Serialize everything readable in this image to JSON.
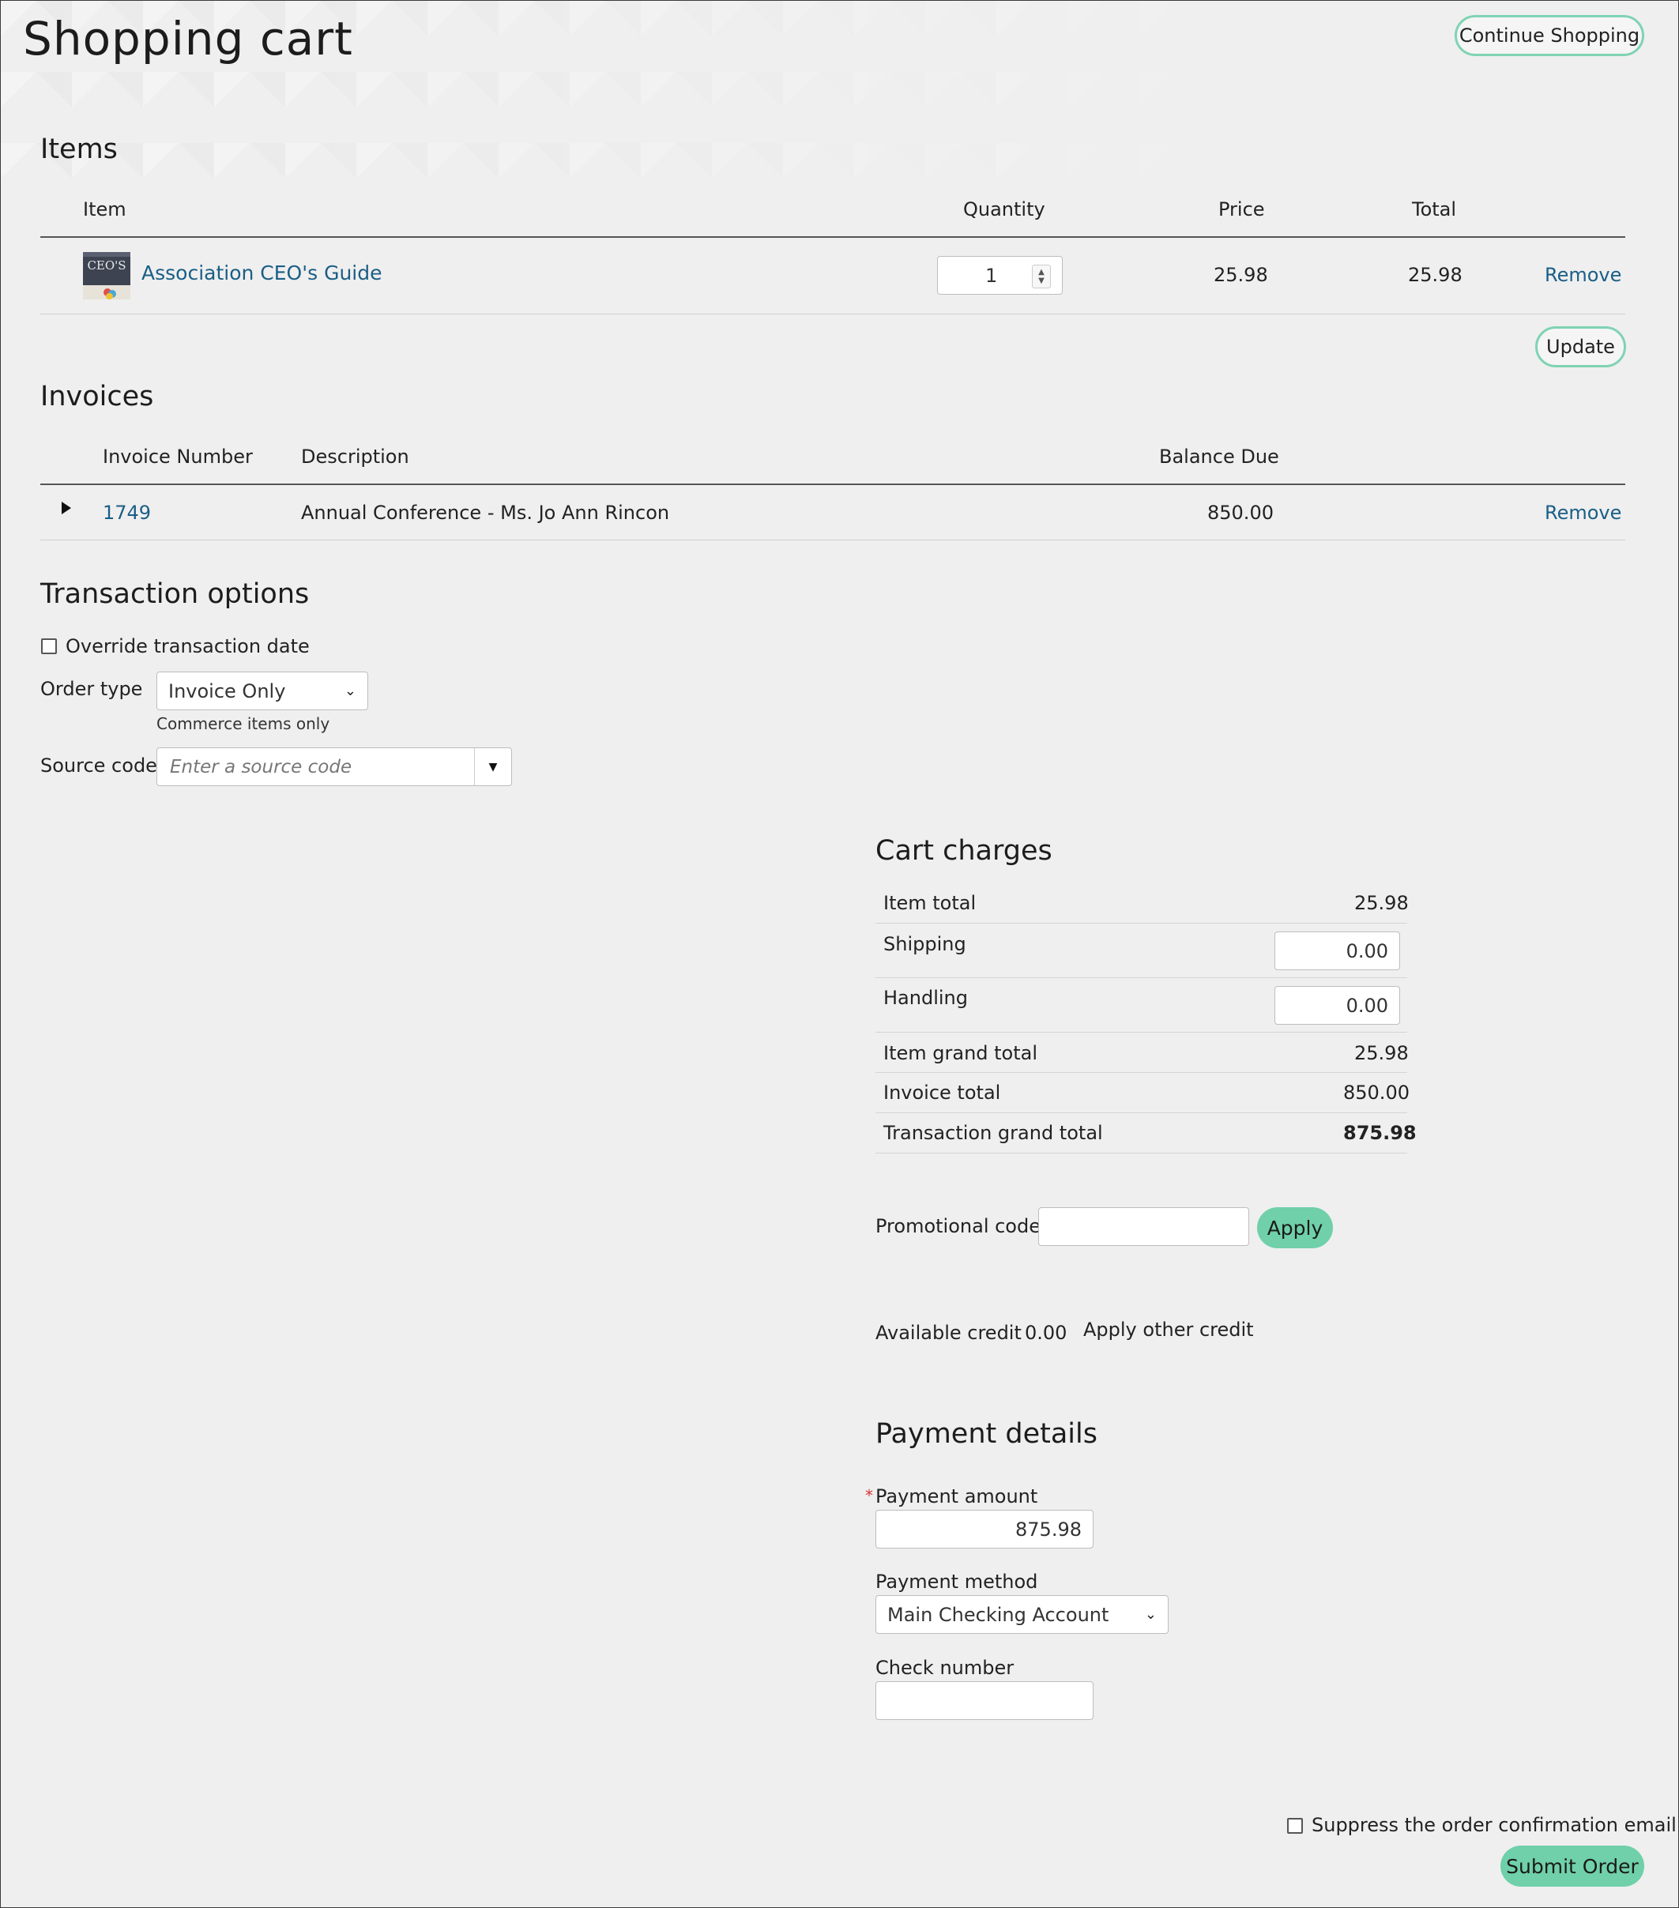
{
  "header": {
    "title": "Shopping cart",
    "continue_label": "Continue Shopping"
  },
  "items": {
    "heading": "Items",
    "columns": {
      "item": "Item",
      "quantity": "Quantity",
      "price": "Price",
      "total": "Total"
    },
    "rows": [
      {
        "thumb_text": "CEO'S",
        "name": "Association CEO's Guide",
        "quantity": "1",
        "price": "25.98",
        "total": "25.98",
        "remove_label": "Remove"
      }
    ],
    "update_label": "Update"
  },
  "invoices": {
    "heading": "Invoices",
    "columns": {
      "number": "Invoice Number",
      "description": "Description",
      "balance": "Balance Due"
    },
    "rows": [
      {
        "number": "1749",
        "description": "Annual Conference - Ms. Jo Ann Rincon",
        "balance": "850.00",
        "remove_label": "Remove"
      }
    ]
  },
  "transaction": {
    "heading": "Transaction options",
    "override_label": "Override transaction date",
    "order_type_label": "Order type",
    "order_type_value": "Invoice Only",
    "order_type_hint": "Commerce items only",
    "source_code_label": "Source code",
    "source_code_placeholder": "Enter a source code"
  },
  "charges": {
    "heading": "Cart charges",
    "item_total_label": "Item total",
    "item_total": "25.98",
    "shipping_label": "Shipping",
    "shipping": "0.00",
    "handling_label": "Handling",
    "handling": "0.00",
    "item_grand_total_label": "Item grand total",
    "item_grand_total": "25.98",
    "invoice_total_label": "Invoice total",
    "invoice_total": "850.00",
    "transaction_grand_total_label": "Transaction grand total",
    "transaction_grand_total": "875.98"
  },
  "promo": {
    "label": "Promotional code",
    "value": "",
    "apply_label": "Apply"
  },
  "credit": {
    "label": "Available credit",
    "value": "0.00",
    "apply_other_label": "Apply other credit"
  },
  "payment": {
    "heading": "Payment details",
    "required_mark": "*",
    "amount_label": "Payment amount",
    "amount": "875.98",
    "method_label": "Payment method",
    "method_value": "Main Checking Account",
    "check_label": "Check number",
    "check_value": ""
  },
  "footer": {
    "suppress_label": "Suppress the order confirmation email",
    "submit_label": "Submit Order"
  },
  "colors": {
    "accent": "#6fd0a9",
    "accent_border": "#7fd3b3",
    "link": "#1a5e86",
    "background": "#efefef"
  }
}
